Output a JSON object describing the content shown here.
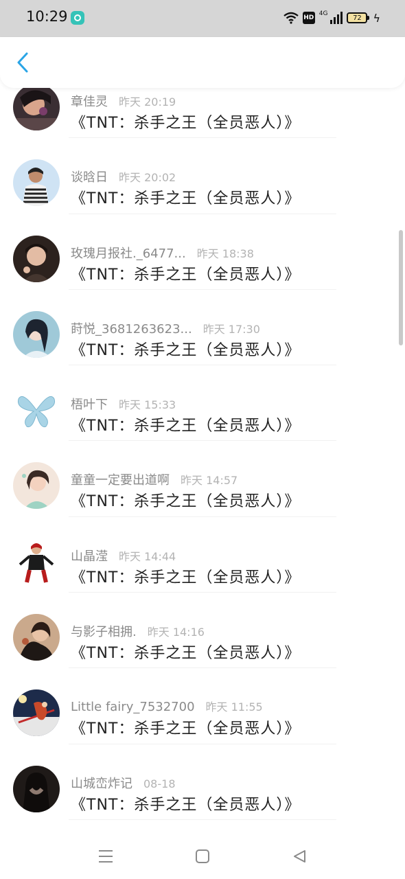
{
  "status_bar": {
    "time": "10:29",
    "network": "4G",
    "hd": "HD",
    "battery": "72"
  },
  "header": {
    "back_icon": "chevron-left-icon",
    "accent": "#2aa5e6"
  },
  "list": {
    "items": [
      {
        "name": "章佳灵",
        "time": "昨天 20:19",
        "message": "《TNT：杀手之王（全员恶人）》"
      },
      {
        "name": "谈晗日",
        "time": "昨天 20:02",
        "message": "《TNT：杀手之王（全员恶人）》"
      },
      {
        "name": "玫瑰月报社._6477...",
        "time": "昨天 18:38",
        "message": "《TNT：杀手之王（全员恶人）》"
      },
      {
        "name": "莳悦_3681263623...",
        "time": "昨天 17:30",
        "message": "《TNT：杀手之王（全员恶人）》"
      },
      {
        "name": "梧叶下",
        "time": "昨天 15:33",
        "message": "《TNT：杀手之王（全员恶人）》"
      },
      {
        "name": "童童一定要出道啊",
        "time": "昨天 14:57",
        "message": "《TNT：杀手之王（全员恶人）》"
      },
      {
        "name": "山晶滢",
        "time": "昨天 14:44",
        "message": "《TNT：杀手之王（全员恶人）》"
      },
      {
        "name": "与影子相拥.",
        "time": "昨天 14:16",
        "message": "《TNT：杀手之王（全员恶人）》"
      },
      {
        "name": "Little fairy_7532700",
        "time": "昨天 11:55",
        "message": "《TNT：杀手之王（全员恶人）》"
      },
      {
        "name": "山城峦炸记",
        "time": "08-18",
        "message": "《TNT：杀手之王（全员恶人）》"
      }
    ]
  },
  "nav_bar": {
    "icons": [
      "menu-icon",
      "home-square-icon",
      "back-triangle-icon"
    ]
  }
}
